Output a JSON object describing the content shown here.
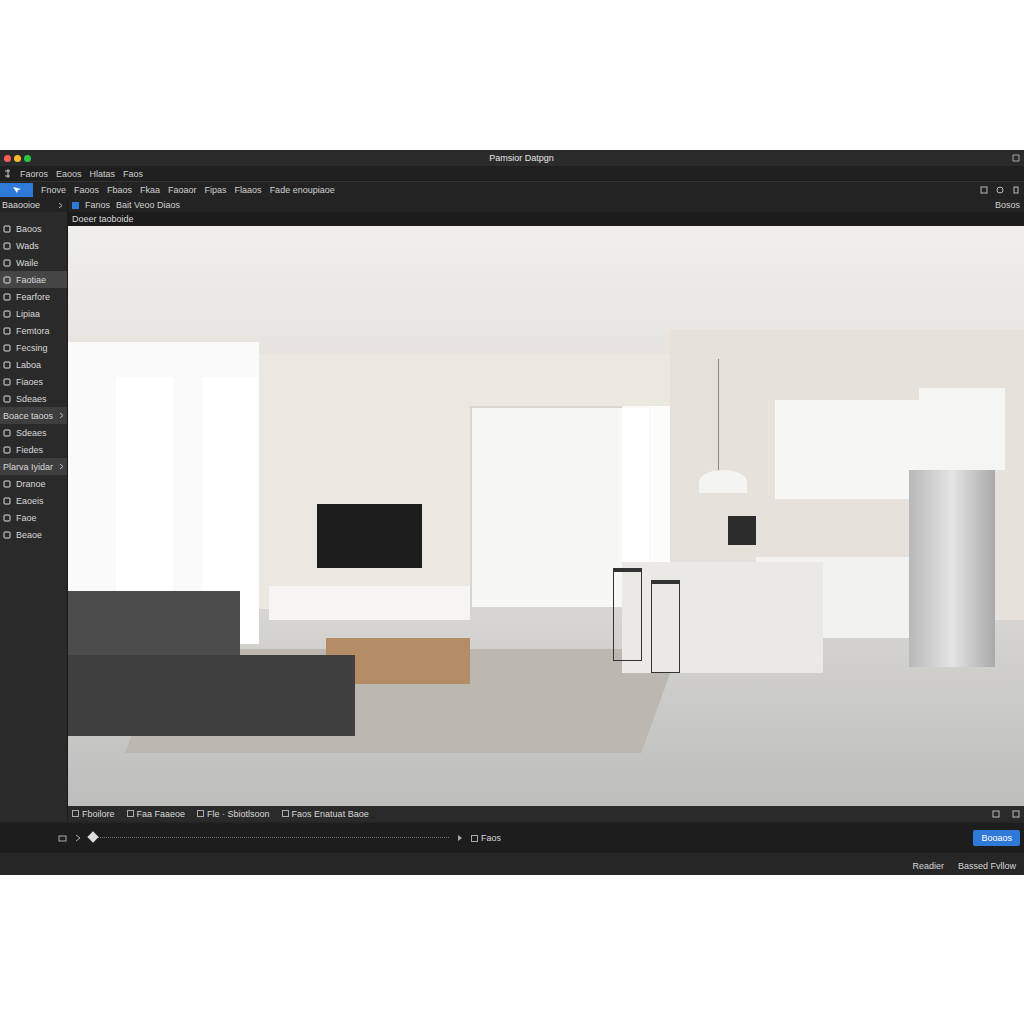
{
  "window": {
    "title": "Pamsior Datpgn"
  },
  "menubar": {
    "items": [
      "Faoros",
      "Eaoos",
      "Hlatas",
      "Faos"
    ]
  },
  "mode_button": {
    "active": true
  },
  "toolbar": {
    "items": [
      "Fnove",
      "Faoos",
      "Fbaos",
      "Fkaa",
      "Faoaor",
      "Fipas",
      "Flaaos",
      "Fade enoupiaoe"
    ]
  },
  "subtoolbar": {
    "items": [
      "Fanos",
      "Bait Veoo Diaos"
    ],
    "right": "Bosos"
  },
  "sidebar": {
    "header": "Baaooioe",
    "items": [
      {
        "label": "Baoos",
        "kind": "item",
        "selected": false
      },
      {
        "label": "Wads",
        "kind": "item",
        "selected": false
      },
      {
        "label": "Waile",
        "kind": "item",
        "selected": false
      },
      {
        "label": "Faotiae",
        "kind": "item",
        "selected": true
      },
      {
        "label": "Fearfore",
        "kind": "item",
        "selected": false
      },
      {
        "label": "Lipiaa",
        "kind": "item",
        "selected": false
      },
      {
        "label": "Femtora",
        "kind": "item",
        "selected": false
      },
      {
        "label": "Fecsing",
        "kind": "item",
        "selected": false
      },
      {
        "label": "Laboa",
        "kind": "item",
        "selected": false
      },
      {
        "label": "Fiaoes",
        "kind": "item",
        "selected": false
      },
      {
        "label": "Sdeaes",
        "kind": "item",
        "selected": false
      },
      {
        "label": "Boace taoos",
        "kind": "group",
        "selected": true
      },
      {
        "label": "Sdeaes",
        "kind": "item",
        "selected": false
      },
      {
        "label": "Fiedes",
        "kind": "item",
        "selected": false
      },
      {
        "label": "Plarva Iyidar",
        "kind": "group",
        "selected": true
      },
      {
        "label": "Dranoe",
        "kind": "item",
        "selected": false
      },
      {
        "label": "Eaoeis",
        "kind": "item",
        "selected": false
      },
      {
        "label": "Faoe",
        "kind": "item",
        "selected": false
      },
      {
        "label": "Beaoe",
        "kind": "item",
        "selected": false
      }
    ]
  },
  "viewport": {
    "title": "Doeer taoboide"
  },
  "bottom_bar": {
    "items": [
      "Fboilore",
      "Faa Faaeoe",
      "Fle · Sbiotlsoon",
      "Faos Enatuat Baoe"
    ]
  },
  "timeline": {
    "label": "Faos",
    "button": "Booaos"
  },
  "status_bar": {
    "items": [
      "Readier",
      "Bassed Fvllow"
    ]
  }
}
